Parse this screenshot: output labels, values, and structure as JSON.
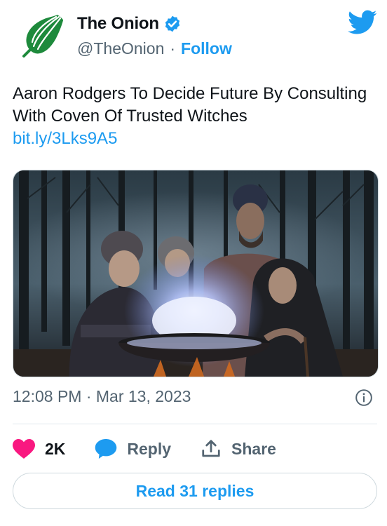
{
  "account": {
    "display_name": "The Onion",
    "handle": "@TheOnion",
    "separator": "·",
    "follow_label": "Follow"
  },
  "tweet": {
    "text": "Aaron Rodgers To Decide Future By Consulting With Coven Of Trusted Witches",
    "link": "bit.ly/3Lks9A5"
  },
  "meta": {
    "timestamp": "12:08 PM · Mar 13, 2023"
  },
  "actions": {
    "like_count": "2K",
    "reply_label": "Reply",
    "share_label": "Share"
  },
  "read_replies_label": "Read 31 replies",
  "colors": {
    "accent": "#1d9bf0",
    "like": "#f91880",
    "onion_green": "#1e8a3c",
    "text": "#0f1419",
    "secondary": "#536471"
  },
  "icons": {
    "avatar": "onion-logo-icon",
    "verified": "verified-badge-icon",
    "brand": "twitter-bird-icon",
    "info": "info-icon",
    "like": "heart-icon",
    "reply": "speech-bubble-icon",
    "share": "share-upload-icon"
  }
}
